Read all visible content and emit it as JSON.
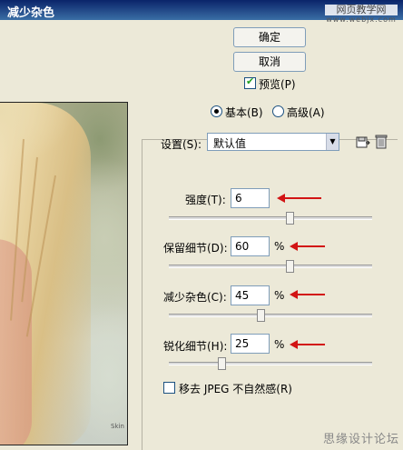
{
  "window": {
    "title": "减少杂色",
    "watermark_line1": "网页教学网",
    "watermark_line2": "www.webjx.com"
  },
  "preview": {
    "image_text": "Skin"
  },
  "buttons": {
    "ok_label": "确定",
    "cancel_label": "取消"
  },
  "preview_checkbox": {
    "label": "预览(P)",
    "checked": true
  },
  "mode": {
    "basic_label": "基本(B)",
    "advanced_label": "高级(A)",
    "selected": "basic"
  },
  "settings": {
    "label": "设置(S):",
    "value": "默认值",
    "save_icon": "save-settings-icon",
    "delete_icon": "trash-icon"
  },
  "params": [
    {
      "label": "强度(T):",
      "value": "6",
      "unit": "",
      "slider_fraction": 0.6
    },
    {
      "label": "保留细节(D):",
      "value": "60",
      "unit": "%",
      "slider_fraction": 0.6
    },
    {
      "label": "减少杂色(C):",
      "value": "45",
      "unit": "%",
      "slider_fraction": 0.45
    },
    {
      "label": "锐化细节(H):",
      "value": "25",
      "unit": "%",
      "slider_fraction": 0.25
    }
  ],
  "jpeg": {
    "label": "移去 JPEG 不自然感(R)",
    "checked": false
  },
  "footer_logo": "思缘设计论坛",
  "colors": {
    "title_bar": "#0a246a",
    "annotation_arrow": "#d21414",
    "dialog_bg": "#ece9d8"
  }
}
